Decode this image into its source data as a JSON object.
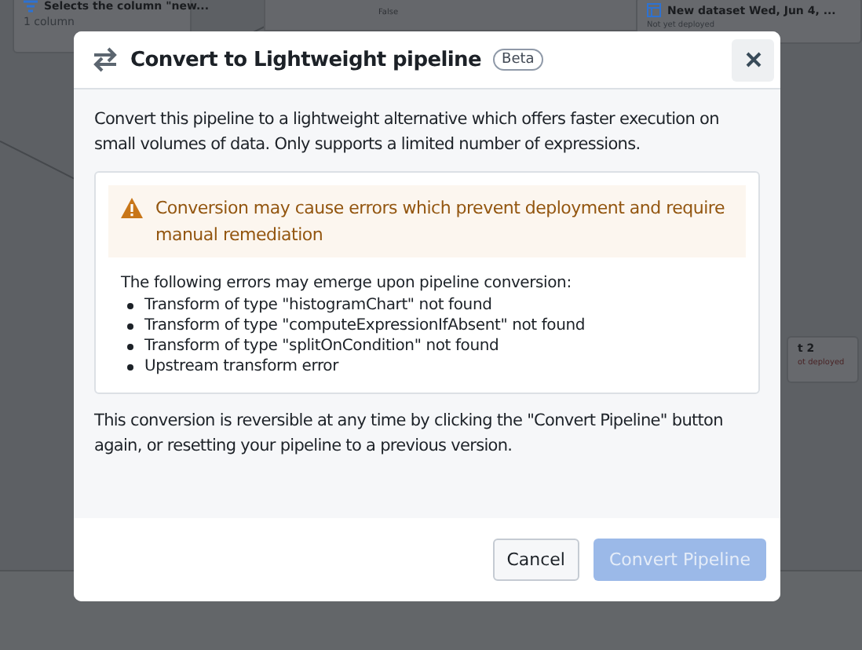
{
  "canvas": {
    "nodes": [
      {
        "title": "Selects the column \"new...",
        "subtitle": "1 column"
      },
      {
        "title": "New dataset Wed, Jun 4, ...",
        "subtitle": "Not yet deployed"
      },
      {
        "title": "t 2",
        "subtitle": "ot deployed"
      }
    ],
    "branch_labels": [
      "False"
    ]
  },
  "dialog": {
    "title": "Convert to Lightweight pipeline",
    "badge": "Beta",
    "description": "Convert this pipeline to a lightweight alternative which offers faster execution on small volumes of data. Only supports a limited number of expressions.",
    "warning": "Conversion may cause errors which prevent deployment and require manual remediation",
    "errors_intro": "The following errors may emerge upon pipeline conversion:",
    "errors": [
      "Transform of type \"histogramChart\" not found",
      "Transform of type \"computeExpressionIfAbsent\" not found",
      "Transform of type \"splitOnCondition\" not found",
      "Upstream transform error"
    ],
    "note": "This conversion is reversible at any time by clicking the \"Convert Pipeline\" button again, or resetting your pipeline to a previous version.",
    "buttons": [
      {
        "label": "Cancel",
        "kind": "secondary",
        "disabled": false
      },
      {
        "label": "Convert Pipeline",
        "kind": "primary",
        "disabled": true
      }
    ]
  }
}
